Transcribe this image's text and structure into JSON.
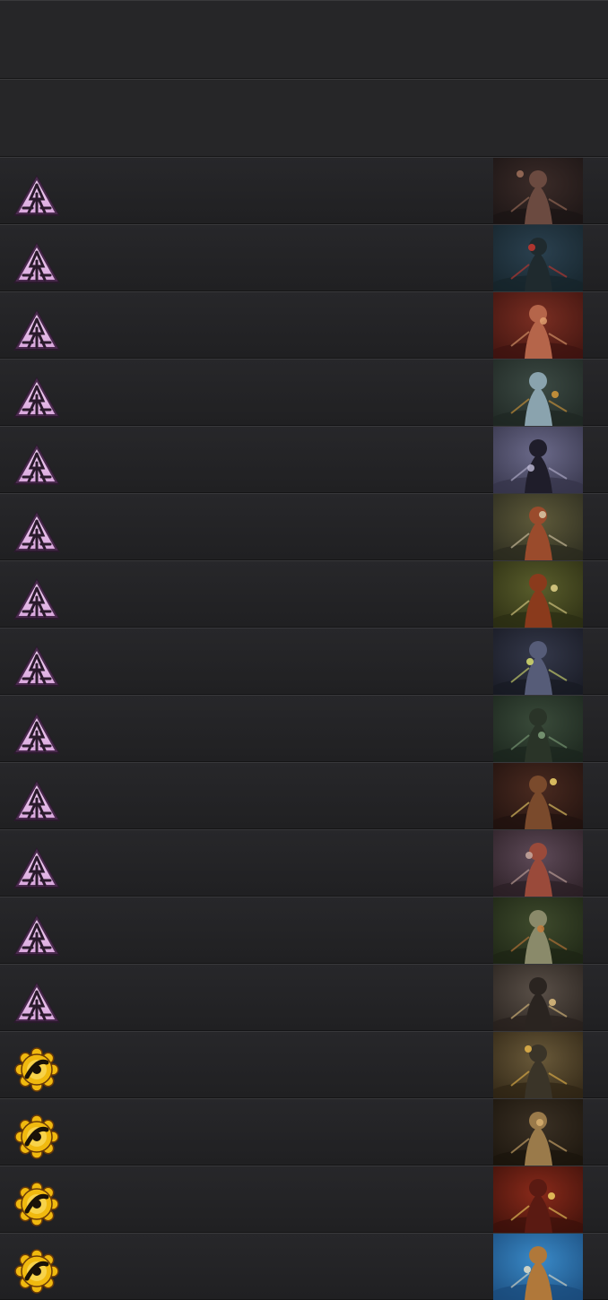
{
  "colors": {
    "background": "#222224",
    "row_border": "#38383b",
    "spire_icon": "#d9a7dd",
    "gear_icon": "#f0b90f"
  },
  "rows": [
    {
      "icon": "spire-icon",
      "thumb": {
        "bg1": "#3b2b28",
        "bg2": "#1a1414",
        "fig": "#6b4a40",
        "accent": "#a0715c"
      }
    },
    {
      "icon": "spire-icon",
      "thumb": {
        "bg1": "#2b4150",
        "bg2": "#15232a",
        "fig": "#1f2a2e",
        "accent": "#c8372f"
      }
    },
    {
      "icon": "spire-icon",
      "thumb": {
        "bg1": "#7a2e22",
        "bg2": "#3d130f",
        "fig": "#b5654a",
        "accent": "#e0a070"
      }
    },
    {
      "icon": "spire-icon",
      "thumb": {
        "bg1": "#3c4a44",
        "bg2": "#1e2622",
        "fig": "#8aa3ae",
        "accent": "#d79a3a"
      }
    },
    {
      "icon": "spire-icon",
      "thumb": {
        "bg1": "#6b6a8a",
        "bg2": "#343348",
        "fig": "#1f1d2a",
        "accent": "#b8b4d0"
      }
    },
    {
      "icon": "spire-icon",
      "thumb": {
        "bg1": "#5e5a3a",
        "bg2": "#2a2a1e",
        "fig": "#9a4b2c",
        "accent": "#d8c9a8"
      }
    },
    {
      "icon": "spire-icon",
      "thumb": {
        "bg1": "#5a5e2c",
        "bg2": "#2a2c12",
        "fig": "#8a3a1c",
        "accent": "#e3d38a"
      }
    },
    {
      "icon": "spire-icon",
      "thumb": {
        "bg1": "#34384a",
        "bg2": "#171922",
        "fig": "#565c78",
        "accent": "#d9e070"
      }
    },
    {
      "icon": "spire-icon",
      "thumb": {
        "bg1": "#3a4b3a",
        "bg2": "#1a241c",
        "fig": "#2a3428",
        "accent": "#7fa07a"
      }
    },
    {
      "icon": "spire-icon",
      "thumb": {
        "bg1": "#4a2a20",
        "bg2": "#1f110e",
        "fig": "#7a4a2c",
        "accent": "#f1d36a"
      }
    },
    {
      "icon": "spire-icon",
      "thumb": {
        "bg1": "#5e4a58",
        "bg2": "#2a1e24",
        "fig": "#9a4a3a",
        "accent": "#c8a9a0"
      }
    },
    {
      "icon": "spire-icon",
      "thumb": {
        "bg1": "#3e4a2c",
        "bg2": "#1c2414",
        "fig": "#8a8a6a",
        "accent": "#c47a3a"
      }
    },
    {
      "icon": "spire-icon",
      "thumb": {
        "bg1": "#5a5048",
        "bg2": "#26201c",
        "fig": "#2a2420",
        "accent": "#e0c080"
      }
    },
    {
      "icon": "gear-icon",
      "thumb": {
        "bg1": "#6a5a3a",
        "bg2": "#2e2414",
        "fig": "#3a3428",
        "accent": "#e8b64a"
      }
    },
    {
      "icon": "gear-icon",
      "thumb": {
        "bg1": "#3a3024",
        "bg2": "#1a140c",
        "fig": "#9a7a4a",
        "accent": "#d8b070"
      }
    },
    {
      "icon": "gear-icon",
      "thumb": {
        "bg1": "#8a2a1a",
        "bg2": "#3a100a",
        "fig": "#5a1a12",
        "accent": "#f0d060"
      }
    },
    {
      "icon": "gear-icon",
      "thumb": {
        "bg1": "#3a8ac8",
        "bg2": "#1a4a7a",
        "fig": "#b0783a",
        "accent": "#e8e0c8"
      }
    }
  ]
}
